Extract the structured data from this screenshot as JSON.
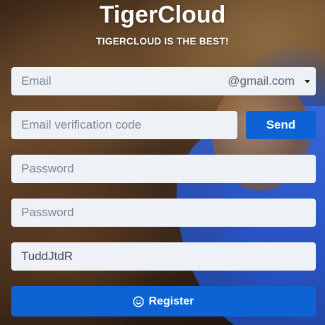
{
  "header": {
    "title": "TigerCloud",
    "subtitle": "TIGERCLOUD IS THE BEST!"
  },
  "form": {
    "email": {
      "placeholder": "Email",
      "domain_selected": "@gmail.com"
    },
    "verification_code": {
      "placeholder": "Email verification code"
    },
    "send_label": "Send",
    "password": {
      "placeholder": "Password"
    },
    "confirm_password": {
      "placeholder": "Password"
    },
    "captcha": {
      "value": "TuddJtdR"
    },
    "register_label": "Register",
    "register_icon": "smile-icon"
  },
  "colors": {
    "accent": "#0d63d3",
    "field_background": "#eef1f6"
  }
}
